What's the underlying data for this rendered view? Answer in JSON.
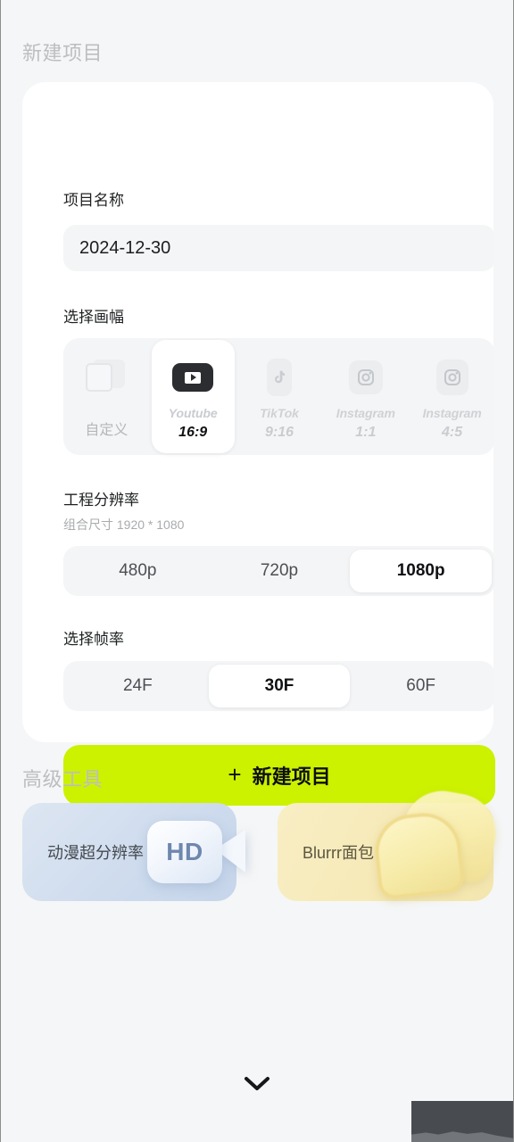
{
  "sections": {
    "new_project_title": "新建项目",
    "advanced_tools_title": "高级工具"
  },
  "project_name": {
    "label": "项目名称",
    "value": "2024-12-30",
    "placeholder": "项目名称"
  },
  "aspect": {
    "label": "选择画幅",
    "options": [
      {
        "platform": "",
        "ratio": "自定义",
        "icon": "custom-frame-icon",
        "selected": false
      },
      {
        "platform": "Youtube",
        "ratio": "16:9",
        "icon": "youtube-icon",
        "selected": true
      },
      {
        "platform": "TikTok",
        "ratio": "9:16",
        "icon": "tiktok-icon",
        "selected": false
      },
      {
        "platform": "Instagram",
        "ratio": "1:1",
        "icon": "instagram-icon",
        "selected": false
      },
      {
        "platform": "Instagram",
        "ratio": "4:5",
        "icon": "instagram-icon",
        "selected": false
      }
    ]
  },
  "resolution": {
    "label": "工程分辨率",
    "sublabel": "组合尺寸 1920 * 1080",
    "options": [
      {
        "label": "480p",
        "selected": false
      },
      {
        "label": "720p",
        "selected": false
      },
      {
        "label": "1080p",
        "selected": true
      }
    ]
  },
  "framerate": {
    "label": "选择帧率",
    "options": [
      {
        "label": "24F",
        "selected": false
      },
      {
        "label": "30F",
        "selected": true
      },
      {
        "label": "60F",
        "selected": false
      }
    ]
  },
  "cta": {
    "plus": "+",
    "label": "新建项目"
  },
  "tools": [
    {
      "label": "动漫超分辨率",
      "art": "hd-camera-icon",
      "badge": "HD"
    },
    {
      "label": "Blurrr面包",
      "art": "bread-icon"
    }
  ],
  "bottom": {
    "collapse_icon": "chevron-down-icon"
  },
  "colors": {
    "accent": "#CCF200",
    "page_bg": "#F5F6F7",
    "card_bg": "#FFFFFF",
    "track_bg": "#F4F5F6",
    "heading": "#BCBEC1",
    "text_primary": "#1E2022",
    "tool_blue": "#CFDCEE",
    "tool_yellow": "#F6E9B6"
  }
}
